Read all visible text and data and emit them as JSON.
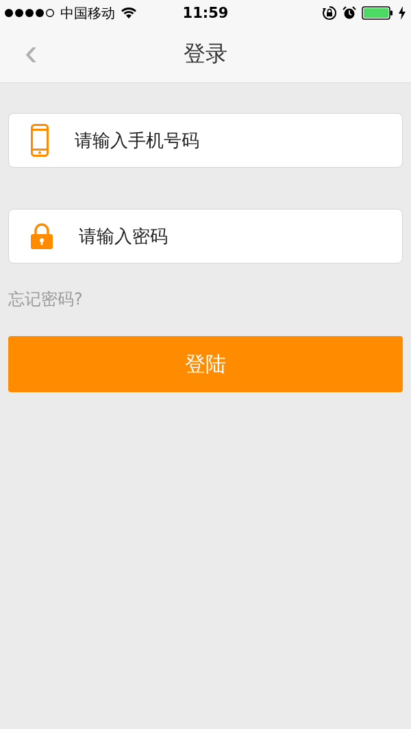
{
  "status_bar": {
    "carrier": "中国移动",
    "time": "11:59"
  },
  "nav": {
    "back": "‹",
    "title": "登录"
  },
  "fields": [
    {
      "kind": "phone",
      "placeholder": "请输入手机号码"
    },
    {
      "kind": "password",
      "placeholder": "请输入密码"
    }
  ],
  "forgot_link": "忘记密码?",
  "login_button": "登陆"
}
